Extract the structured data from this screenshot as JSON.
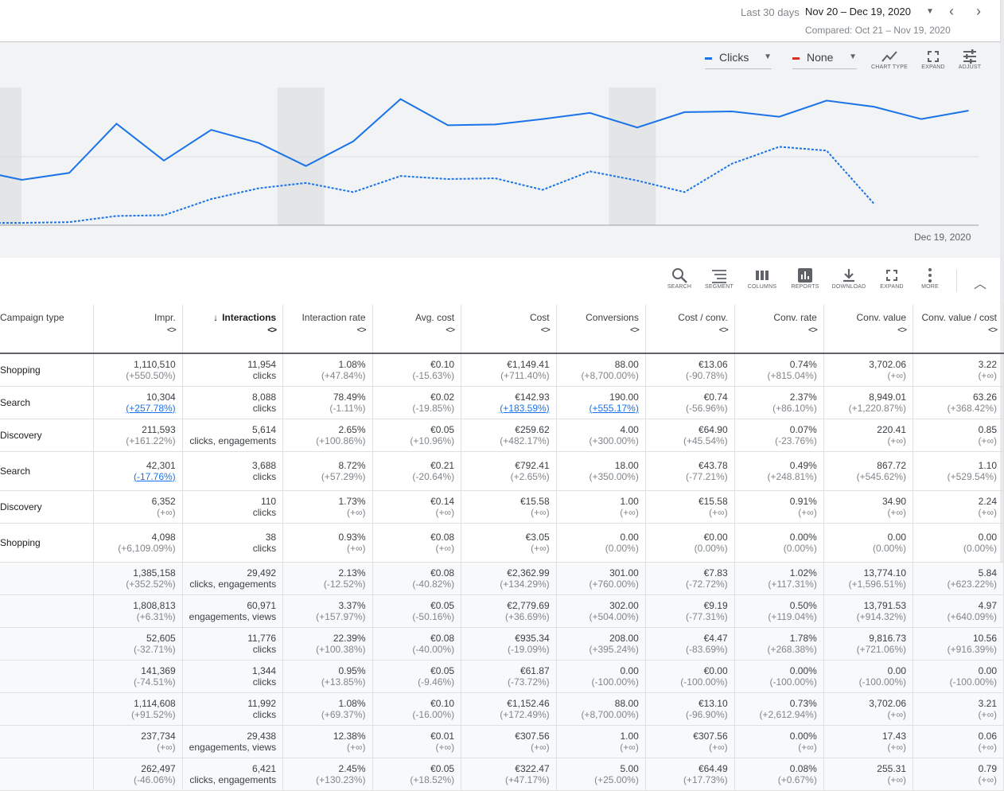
{
  "header": {
    "date_label": "Last 30 days",
    "date_range": "Nov 20 – Dec 19, 2020",
    "compared": "Compared: Oct 21 – Nov 19, 2020"
  },
  "chart_controls": {
    "metric1": "Clicks",
    "metric1_color": "#1a73e8",
    "metric2": "None",
    "metric2_color": "#d93025",
    "chart_type": "CHART TYPE",
    "expand": "EXPAND",
    "adjust": "ADJUST"
  },
  "chart_data": {
    "type": "line",
    "x_end_label": "Dec 19, 2020",
    "series": [
      {
        "style": "solid",
        "color": "#1a73e8",
        "values": [
          68,
          55,
          64,
          128,
          80,
          120,
          103,
          73,
          105,
          160,
          126,
          127,
          134,
          142,
          123,
          143,
          144,
          137,
          158,
          150,
          134,
          145
        ]
      },
      {
        "style": "dashed",
        "color": "#1a73e8",
        "values": [
          -1,
          -1,
          0,
          8,
          9,
          30,
          44,
          51,
          39,
          60,
          56,
          57,
          42,
          66,
          54,
          39,
          76,
          98,
          93,
          24
        ]
      }
    ],
    "ylim": [
      -4,
      175
    ],
    "weekend_bands": [
      [
        -0.1,
        0.35
      ],
      [
        6.4,
        7.4
      ],
      [
        13.4,
        14.4
      ]
    ]
  },
  "table_toolbar": {
    "search": "SEARCH",
    "segment": "SEGMENT",
    "columns": "COLUMNS",
    "reports": "REPORTS",
    "download": "DOWNLOAD",
    "expand": "EXPAND",
    "more": "MORE"
  },
  "table": {
    "headers": [
      "Campaign type",
      "Impr.",
      "Interactions",
      "Interaction rate",
      "Avg. cost",
      "Cost",
      "Conversions",
      "Cost / conv.",
      "Conv. rate",
      "Conv. value",
      "Conv. value / cost"
    ],
    "sort_arrow": "↓",
    "sort_toggle": "<>",
    "rows": [
      {
        "type": "Shopping",
        "cells": [
          [
            "1,110,510",
            "(+550.50%)"
          ],
          [
            "11,954",
            "clicks"
          ],
          [
            "1.08%",
            "(+47.84%)"
          ],
          [
            "€0.10",
            "(-15.63%)"
          ],
          [
            "€1,149.41",
            "(+711.40%)"
          ],
          [
            "88.00",
            "(+8,700.00%)"
          ],
          [
            "€13.06",
            "(-90.78%)"
          ],
          [
            "0.74%",
            "(+815.04%)"
          ],
          [
            "3,702.06",
            "(+∞)"
          ],
          [
            "3.22",
            "(+∞)"
          ]
        ]
      },
      {
        "type": "Search",
        "cells": [
          [
            "10,304",
            "(+257.78%)"
          ],
          [
            "8,088",
            "clicks"
          ],
          [
            "78.49%",
            "(-1.11%)"
          ],
          [
            "€0.02",
            "(-19.85%)"
          ],
          [
            "€142.93",
            "(+183.59%)"
          ],
          [
            "190.00",
            "(+555.17%)"
          ],
          [
            "€0.74",
            "(-56.96%)"
          ],
          [
            "2.37%",
            "(+86.10%)"
          ],
          [
            "8,949.01",
            "(+1,220.87%)"
          ],
          [
            "63.26",
            "(+368.42%)"
          ]
        ]
      },
      {
        "type": "Discovery",
        "cells": [
          [
            "211,593",
            "(+161.22%)"
          ],
          [
            "5,614",
            "clicks, engagements"
          ],
          [
            "2.65%",
            "(+100.86%)"
          ],
          [
            "€0.05",
            "(+10.96%)"
          ],
          [
            "€259.62",
            "(+482.17%)"
          ],
          [
            "4.00",
            "(+300.00%)"
          ],
          [
            "€64.90",
            "(+45.54%)"
          ],
          [
            "0.07%",
            "(-23.76%)"
          ],
          [
            "220.41",
            "(+∞)"
          ],
          [
            "0.85",
            "(+∞)"
          ]
        ]
      },
      {
        "type": "Search",
        "cells": [
          [
            "42,301",
            "(-17.76%)"
          ],
          [
            "3,688",
            "clicks"
          ],
          [
            "8.72%",
            "(+57.29%)"
          ],
          [
            "€0.21",
            "(-20.64%)"
          ],
          [
            "€792.41",
            "(+2.65%)"
          ],
          [
            "18.00",
            "(+350.00%)"
          ],
          [
            "€43.78",
            "(-77.21%)"
          ],
          [
            "0.49%",
            "(+248.81%)"
          ],
          [
            "867.72",
            "(+545.62%)"
          ],
          [
            "1.10",
            "(+529.54%)"
          ]
        ]
      },
      {
        "type": "Discovery",
        "cells": [
          [
            "6,352",
            "(+∞)"
          ],
          [
            "110",
            "clicks"
          ],
          [
            "1.73%",
            "(+∞)"
          ],
          [
            "€0.14",
            "(+∞)"
          ],
          [
            "€15.58",
            "(+∞)"
          ],
          [
            "1.00",
            "(+∞)"
          ],
          [
            "€15.58",
            "(+∞)"
          ],
          [
            "0.91%",
            "(+∞)"
          ],
          [
            "34.90",
            "(+∞)"
          ],
          [
            "2.24",
            "(+∞)"
          ]
        ]
      },
      {
        "type": "Shopping",
        "cells": [
          [
            "4,098",
            "(+6,109.09%)"
          ],
          [
            "38",
            "clicks"
          ],
          [
            "0.93%",
            "(+∞)"
          ],
          [
            "€0.08",
            "(+∞)"
          ],
          [
            "€3.05",
            "(+∞)"
          ],
          [
            "0.00",
            "(0.00%)"
          ],
          [
            "€0.00",
            "(0.00%)"
          ],
          [
            "0.00%",
            "(0.00%)"
          ],
          [
            "0.00",
            "(0.00%)"
          ],
          [
            "0.00",
            "(0.00%)"
          ]
        ]
      },
      {
        "type": "",
        "cells": [
          [
            "1,385,158",
            "(+352.52%)"
          ],
          [
            "29,492",
            "clicks, engagements"
          ],
          [
            "2.13%",
            "(-12.52%)"
          ],
          [
            "€0.08",
            "(-40.82%)"
          ],
          [
            "€2,362.99",
            "(+134.29%)"
          ],
          [
            "301.00",
            "(+760.00%)"
          ],
          [
            "€7.83",
            "(-72.72%)"
          ],
          [
            "1.02%",
            "(+117.31%)"
          ],
          [
            "13,774.10",
            "(+1,596.51%)"
          ],
          [
            "5.84",
            "(+623.22%)"
          ]
        ]
      },
      {
        "type": "",
        "cells": [
          [
            "1,808,813",
            "(+6.31%)"
          ],
          [
            "60,971",
            "engagements, views"
          ],
          [
            "3.37%",
            "(+157.97%)"
          ],
          [
            "€0.05",
            "(-50.16%)"
          ],
          [
            "€2,779.69",
            "(+36.69%)"
          ],
          [
            "302.00",
            "(+504.00%)"
          ],
          [
            "€9.19",
            "(-77.31%)"
          ],
          [
            "0.50%",
            "(+119.04%)"
          ],
          [
            "13,791.53",
            "(+914.32%)"
          ],
          [
            "4.97",
            "(+640.09%)"
          ]
        ]
      },
      {
        "type": "",
        "cells": [
          [
            "52,605",
            "(-32.71%)"
          ],
          [
            "11,776",
            "clicks"
          ],
          [
            "22.39%",
            "(+100.38%)"
          ],
          [
            "€0.08",
            "(-40.00%)"
          ],
          [
            "€935.34",
            "(-19.09%)"
          ],
          [
            "208.00",
            "(+395.24%)"
          ],
          [
            "€4.47",
            "(-83.69%)"
          ],
          [
            "1.78%",
            "(+268.38%)"
          ],
          [
            "9,816.73",
            "(+721.06%)"
          ],
          [
            "10.56",
            "(+916.39%)"
          ]
        ]
      },
      {
        "type": "",
        "cells": [
          [
            "141,369",
            "(-74.51%)"
          ],
          [
            "1,344",
            "clicks"
          ],
          [
            "0.95%",
            "(+13.85%)"
          ],
          [
            "€0.05",
            "(-9.46%)"
          ],
          [
            "€61.87",
            "(-73.72%)"
          ],
          [
            "0.00",
            "(-100.00%)"
          ],
          [
            "€0.00",
            "(-100.00%)"
          ],
          [
            "0.00%",
            "(-100.00%)"
          ],
          [
            "0.00",
            "(-100.00%)"
          ],
          [
            "0.00",
            "(-100.00%)"
          ]
        ]
      },
      {
        "type": "",
        "cells": [
          [
            "1,114,608",
            "(+91.52%)"
          ],
          [
            "11,992",
            "clicks"
          ],
          [
            "1.08%",
            "(+69.37%)"
          ],
          [
            "€0.10",
            "(-16.00%)"
          ],
          [
            "€1,152.46",
            "(+172.49%)"
          ],
          [
            "88.00",
            "(+8,700.00%)"
          ],
          [
            "€13.10",
            "(-96.90%)"
          ],
          [
            "0.73%",
            "(+2,612.94%)"
          ],
          [
            "3,702.06",
            "(+∞)"
          ],
          [
            "3.21",
            "(+∞)"
          ]
        ]
      },
      {
        "type": "",
        "cells": [
          [
            "237,734",
            "(+∞)"
          ],
          [
            "29,438",
            "engagements, views"
          ],
          [
            "12.38%",
            "(+∞)"
          ],
          [
            "€0.01",
            "(+∞)"
          ],
          [
            "€307.56",
            "(+∞)"
          ],
          [
            "1.00",
            "(+∞)"
          ],
          [
            "€307.56",
            "(+∞)"
          ],
          [
            "0.00%",
            "(+∞)"
          ],
          [
            "17.43",
            "(+∞)"
          ],
          [
            "0.06",
            "(+∞)"
          ]
        ]
      },
      {
        "type": "",
        "cells": [
          [
            "262,497",
            "(-46.06%)"
          ],
          [
            "6,421",
            "clicks, engagements"
          ],
          [
            "2.45%",
            "(+130.23%)"
          ],
          [
            "€0.05",
            "(+18.52%)"
          ],
          [
            "€322.47",
            "(+47.17%)"
          ],
          [
            "5.00",
            "(+25.00%)"
          ],
          [
            "€64.49",
            "(+17.73%)"
          ],
          [
            "0.08%",
            "(+0.67%)"
          ],
          [
            "255.31",
            "(+∞)"
          ],
          [
            "0.79",
            "(+∞)"
          ]
        ]
      }
    ]
  }
}
